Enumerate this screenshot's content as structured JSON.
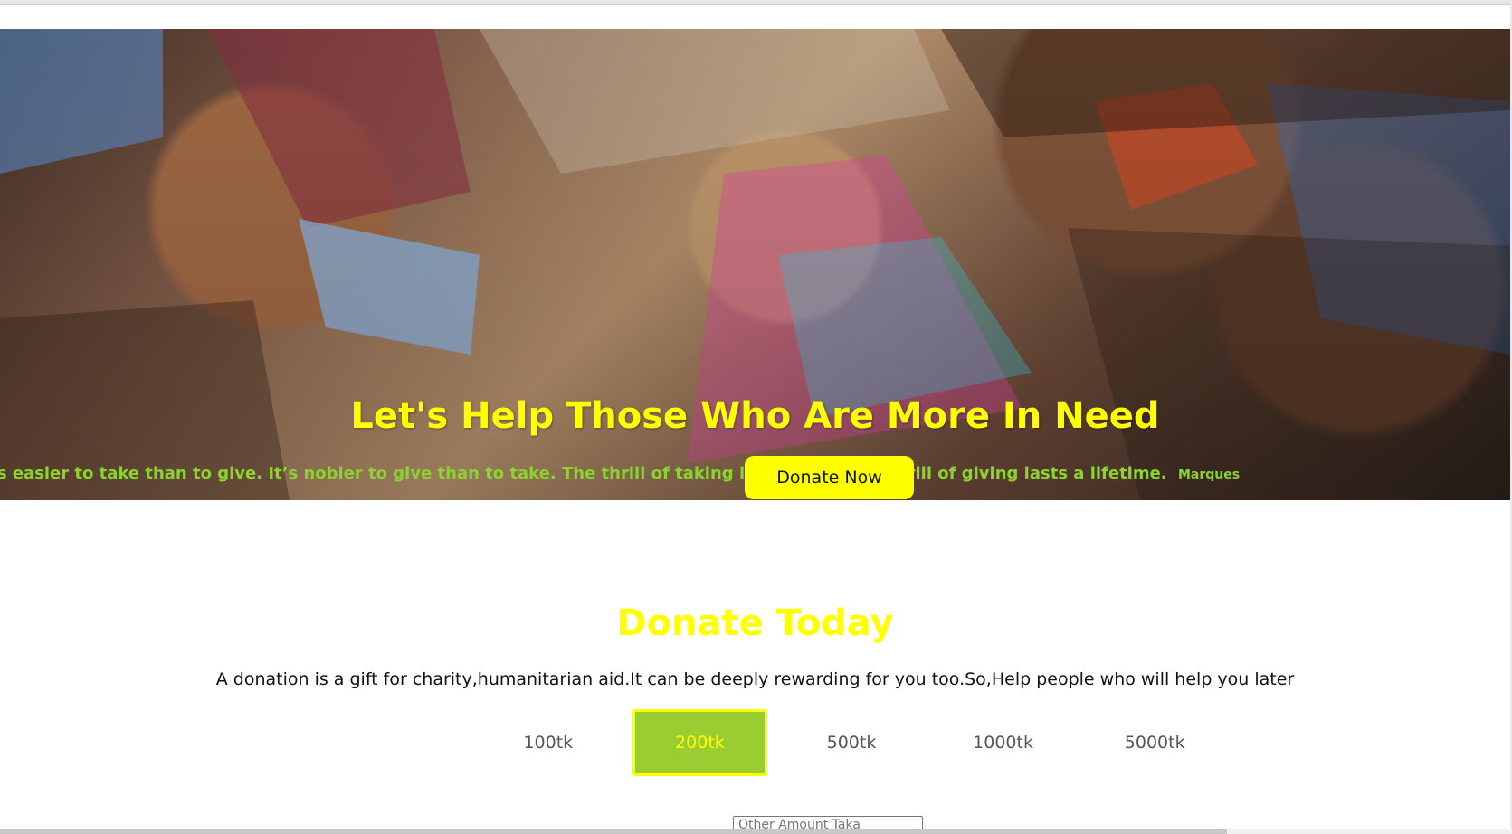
{
  "hero": {
    "title": "Let's Help Those Who Are More In Need",
    "quote": "’s easier to take than to give. It’s nobler to give than to take. The thrill of taking lasts a day. The thrill of giving lasts a lifetime.",
    "quote_author": "Marques",
    "donate_label": "Donate Now"
  },
  "donate_section": {
    "title": "Donate Today",
    "description": "A donation is a gift for charity,humanitarian aid.It can be deeply rewarding for you too.So,Help people who will help you later",
    "amounts": [
      "100tk",
      "200tk",
      "500tk",
      "1000tk",
      "5000tk"
    ],
    "selected_amount": "200tk",
    "other_amount_placeholder": "Other Amount Taka"
  }
}
